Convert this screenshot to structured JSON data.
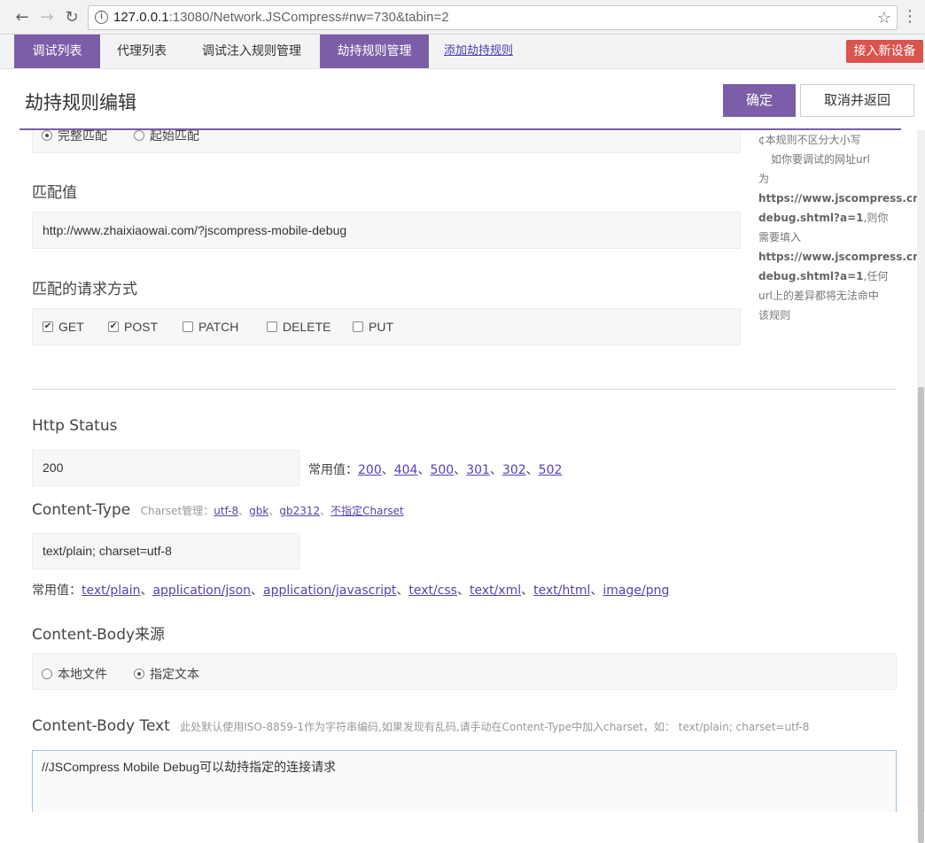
{
  "browser": {
    "url_host": "127.0.0.1",
    "url_rest": ":13080/Network.JSCompress#nw=730&tabin=2"
  },
  "appnav": {
    "tabs": [
      "调试列表",
      "代理列表",
      "调试注入规则管理",
      "劫持规则管理"
    ],
    "add_link": "添加劫持规则",
    "connect_btn": "接入新设备"
  },
  "header": {
    "title": "劫持规则编辑",
    "ok": "确定",
    "cancel": "取消并返回"
  },
  "match_type": {
    "options": [
      "完整匹配",
      "起始匹配"
    ],
    "selected": "完整匹配"
  },
  "match_value": {
    "label": "匹配值",
    "value": "http://www.zhaixiaowai.com/?jscompress-mobile-debug"
  },
  "methods": {
    "label": "匹配的请求方式",
    "items": [
      {
        "name": "GET",
        "checked": true
      },
      {
        "name": "POST",
        "checked": true
      },
      {
        "name": "PATCH",
        "checked": false
      },
      {
        "name": "DELETE",
        "checked": false
      },
      {
        "name": "PUT",
        "checked": false
      }
    ]
  },
  "hint": {
    "line1": "¢本规则不区分大小写",
    "line2": "如你要调试的网址url",
    "line3": "为",
    "line4": "https://www.jscompress.cn/m",
    "line5a": "debug.shtml?a=1",
    "line5b": ",则你",
    "line6": "需要填入",
    "line7": "https://www.jscompress.cn/m",
    "line8a": "debug.shtml?a=1",
    "line8b": ",任何",
    "line9": "url上的差异都将无法命中",
    "line10": "该规则"
  },
  "http_status": {
    "label": "Http Status",
    "value": "200",
    "common_label": "常用值：",
    "common": [
      "200",
      "404",
      "500",
      "301",
      "302",
      "502"
    ]
  },
  "content_type": {
    "label": "Content-Type",
    "charset_label": "Charset管理：",
    "charsets": [
      "utf-8",
      "gbk",
      "gb2312",
      "不指定Charset"
    ],
    "value": "text/plain; charset=utf-8",
    "common_label": "常用值：",
    "common": [
      "text/plain",
      "application/json",
      "application/javascript",
      "text/css",
      "text/xml",
      "text/html",
      "image/png"
    ]
  },
  "body_source": {
    "label": "Content-Body来源",
    "options": [
      "本地文件",
      "指定文本"
    ],
    "selected": "指定文本"
  },
  "body_text": {
    "label": "Content-Body Text",
    "note": "此处默认使用ISO-8859-1作为字符串编码,如果发现有乱码,请手动在Content-Type中加入charset，如： text/plain; charset=utf-8",
    "value": "//JSCompress Mobile Debug可以劫持指定的连接请求"
  }
}
